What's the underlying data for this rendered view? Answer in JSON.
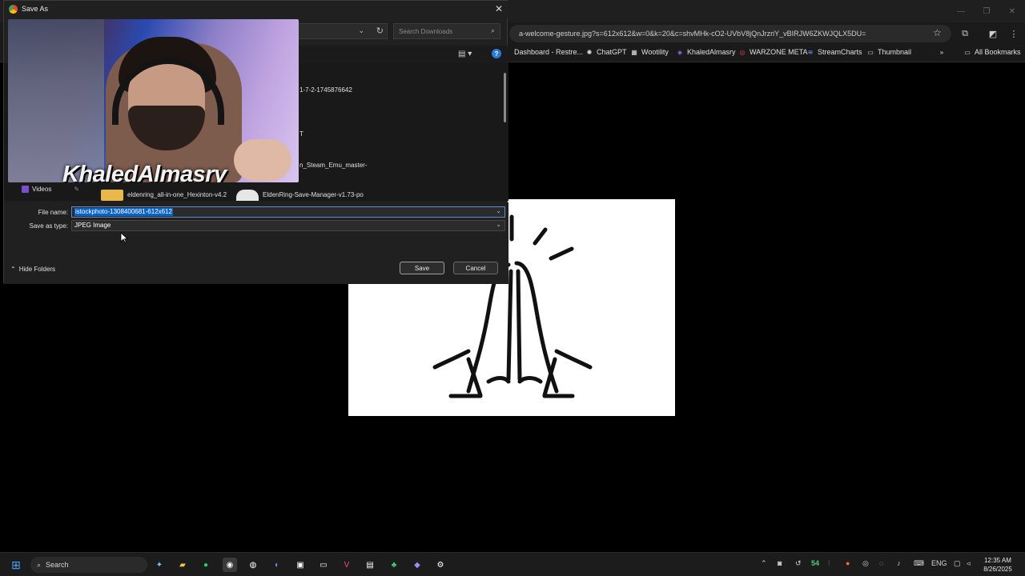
{
  "browser": {
    "url": "a-welcome-gesture.jpg?s=612x612&w=0&k=20&c=shvMHk-cO2-UVbV8jQnJrzriY_vBIRJW6ZKWJQLX5DU=",
    "bookmarks": [
      {
        "label": "Dashboard - Restre...",
        "icon": "restream-icon"
      },
      {
        "label": "ChatGPT",
        "icon": "chatgpt-icon"
      },
      {
        "label": "Wootility",
        "icon": "wootility-icon"
      },
      {
        "label": "KhaledAlmasry",
        "icon": "twitch-icon"
      },
      {
        "label": "WARZONE META",
        "icon": "warzone-icon"
      },
      {
        "label": "StreamCharts",
        "icon": "streamcharts-icon"
      },
      {
        "label": "Thumbnail",
        "icon": "folder-icon"
      }
    ],
    "all_bookmarks": "All Bookmarks"
  },
  "dialog": {
    "title": "Save As",
    "search_placeholder": "Search Downloads",
    "files": {
      "partial_1": "1-7-2-1745876642",
      "partial_2": "T",
      "partial_3": "n_Steam_Emu_master-",
      "file_1": "eldenring_all-in-one_Hexinton-v4.2",
      "file_2": "EldenRing-Save-Manager-v1.73-po"
    },
    "nav_videos": "Videos",
    "file_name_label": "File name:",
    "file_name_value": "istockphoto-1308400681-612x612",
    "save_type_label": "Save as type:",
    "save_type_value": "JPEG Image",
    "hide_folders": "Hide Folders",
    "save_button": "Save",
    "cancel_button": "Cancel"
  },
  "webcam": {
    "watermark": "KhaledAlmasry"
  },
  "taskbar": {
    "search_label": "Search",
    "tray_number": "54",
    "language": "ENG",
    "time": "12:35 AM",
    "date": "8/26/2025"
  }
}
